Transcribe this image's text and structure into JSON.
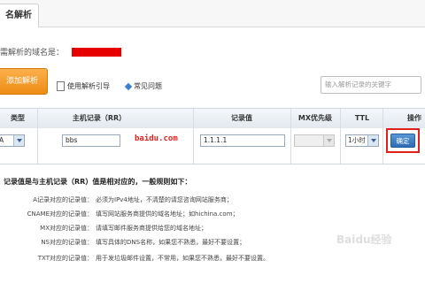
{
  "tab": {
    "label": "名解析"
  },
  "domain": {
    "label": "需解析的域名是："
  },
  "toolbar": {
    "add_label": "添加解析",
    "guide_label": "使用解析引导",
    "faq_label": "常见问题",
    "search_placeholder": "输入解析记录的关键字"
  },
  "table": {
    "headers": [
      "类型",
      "主机记录（RR）",
      "记录值",
      "MX优先级",
      "TTL",
      "操作"
    ],
    "row": {
      "type": "A",
      "host": "bbs",
      "domain_suffix": "baidu.com",
      "value": "1.1.1.1",
      "mx": "",
      "ttl": "1小时",
      "confirm": "确定"
    }
  },
  "rules": {
    "title": "记录值是与主机记录（RR）值是相对应的，一般规则如下：",
    "items": [
      {
        "label": "A记录对应的记录值：",
        "desc": "必须为IPv4地址，不清楚的请您咨询网站服务商；"
      },
      {
        "label": "CNAME对应的记录值：",
        "desc": "填写网站服务商提供的域名地址；如hichina.com；"
      },
      {
        "label": "MX对应的记录值：",
        "desc": "请填写邮件服务商提供给您的域名地址；"
      },
      {
        "label": "NS对应的记录值：",
        "desc": "填写具体的DNS名称，如果您不熟悉，最好不要设置；"
      },
      {
        "label": "TXT对应的记录值：",
        "desc": "用于发垃圾邮件设置，不常用，如果您不熟悉，最好不要设置。"
      }
    ]
  },
  "watermark": "Baidu经验",
  "colors": {
    "accent_orange": "#f39c1f",
    "highlight_red": "#e0201b",
    "button_blue": "#2d6cb4"
  }
}
